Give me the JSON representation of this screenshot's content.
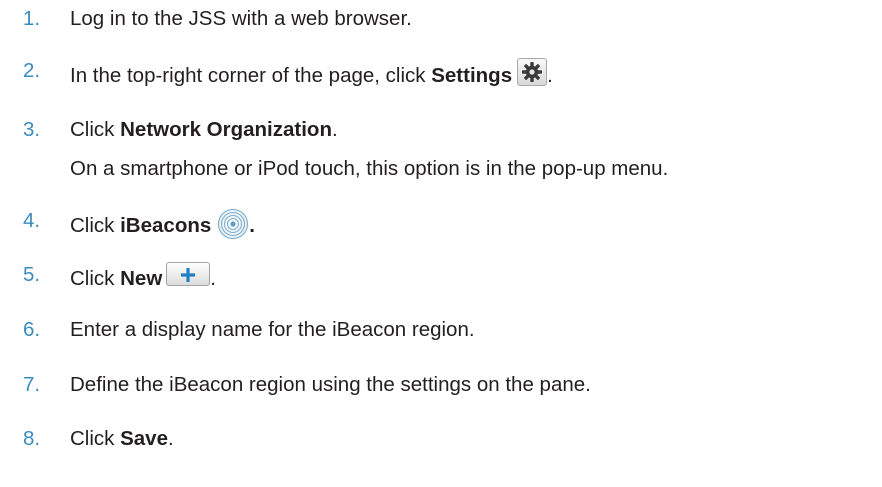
{
  "steps": [
    {
      "number": "1.",
      "text": "Log in to the JSS with a web browser."
    },
    {
      "number": "2.",
      "pre": "In the top-right corner of the page, click ",
      "bold": "Settings",
      "post": ".",
      "icon": "gear-icon"
    },
    {
      "number": "3.",
      "pre": "Click ",
      "bold": "Network Organization",
      "post": ".",
      "note": "On a smartphone or iPod touch, this option is in the pop-up menu."
    },
    {
      "number": "4.",
      "pre": "Click ",
      "bold": "iBeacons",
      "post": ".",
      "icon": "ibeacon-icon"
    },
    {
      "number": "5.",
      "pre": "Click ",
      "bold": "New",
      "post": ".",
      "icon": "plus-icon"
    },
    {
      "number": "6.",
      "text": "Enter a display name for the iBeacon region."
    },
    {
      "number": "7.",
      "text": "Define the iBeacon region using the settings on the pane."
    },
    {
      "number": "8.",
      "pre": "Click ",
      "bold": "Save",
      "post": "."
    }
  ],
  "colors": {
    "step_number": "#3a8bbf",
    "text": "#231f20",
    "plus": "#1f7fc6"
  }
}
